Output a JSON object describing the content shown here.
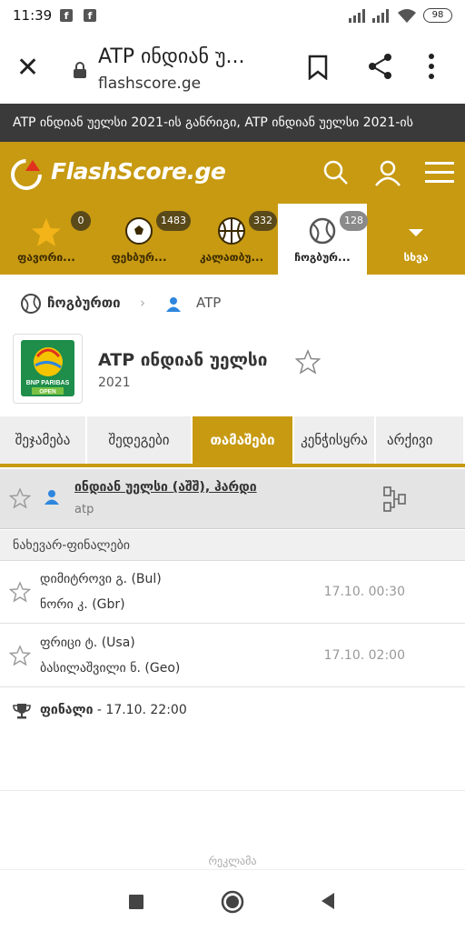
{
  "status_bar": {
    "time": "11:39",
    "battery": "98"
  },
  "browser": {
    "title": "ATP ინდიან უ...",
    "url": "flashscore.ge"
  },
  "ticker": {
    "text": "ATP ინდიან უელსი 2021-ის განრიგი, ATP ინდიან უელსი 2021-ის"
  },
  "header": {
    "logo_text": "FlashScore.ge"
  },
  "sports_tabs": [
    {
      "label": "ფავორი...",
      "badge": "0",
      "icon": "star-icon"
    },
    {
      "label": "ფეხბურ...",
      "badge": "1483",
      "icon": "soccer-ball-icon"
    },
    {
      "label": "კალათბუ...",
      "badge": "332",
      "icon": "basketball-icon"
    },
    {
      "label": "ჩოგბურ...",
      "badge": "128",
      "icon": "tennis-ball-icon",
      "active": true
    },
    {
      "label": "სხვა",
      "icon": "chevron-down-icon"
    }
  ],
  "breadcrumb": {
    "sport": "ჩოგბურთი",
    "category": "ATP"
  },
  "tournament": {
    "name": "ATP ინდიან უელსი",
    "year": "2021",
    "logo_text_1": "BNP PARIBAS",
    "logo_text_2": "OPEN"
  },
  "page_tabs": [
    {
      "label": "შეჯამება"
    },
    {
      "label": "შედეგები"
    },
    {
      "label": "თამაშები",
      "active": true
    },
    {
      "label": "კენჭისყრა"
    },
    {
      "label": "არქივი"
    }
  ],
  "league": {
    "name": "ინდიან უელსი (აშშ), ჰარდი",
    "sub": "atp"
  },
  "round": {
    "title": "ნახევარ-ფინალები"
  },
  "matches": [
    {
      "player1": "დიმიტროვი გ. (Bul)",
      "player2": "ნორი კ. (Gbr)",
      "time": "17.10. 00:30"
    },
    {
      "player1": "ფრიცი ტ. (Usa)",
      "player2": "ბასილაშვილი ნ. (Geo)",
      "time": "17.10. 02:00"
    }
  ],
  "final": {
    "label": "ფინალი",
    "time": " - 17.10. 22:00"
  },
  "ad": {
    "label": "რეკლამა"
  },
  "colors": {
    "brand": "#c79a12",
    "ticker_bg": "#3a3a3a",
    "accent_red": "#e0321e"
  }
}
